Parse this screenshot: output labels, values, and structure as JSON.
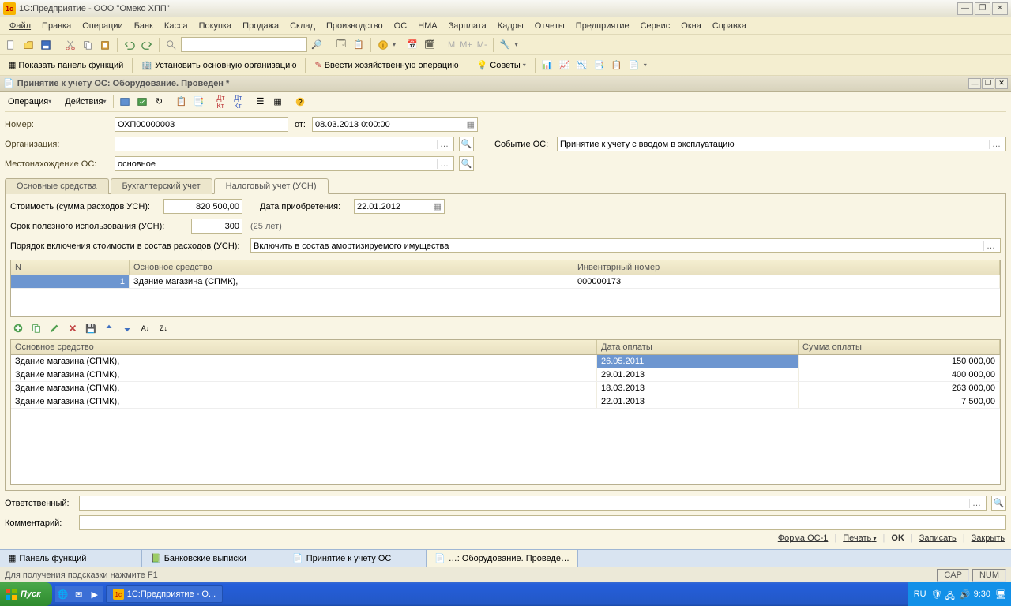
{
  "titlebar": {
    "title": "1С:Предприятие - ООО \"Омеко ХПП\""
  },
  "menubar": [
    "Файл",
    "Правка",
    "Операции",
    "Банк",
    "Касса",
    "Покупка",
    "Продажа",
    "Склад",
    "Производство",
    "ОС",
    "НМА",
    "Зарплата",
    "Кадры",
    "Отчеты",
    "Предприятие",
    "Сервис",
    "Окна",
    "Справка"
  ],
  "toolbar2": {
    "panel_func": "Показать панель функций",
    "set_org": "Установить основную организацию",
    "enter_op": "Ввести хозяйственную операцию",
    "tips": "Советы"
  },
  "subwin": {
    "title": "Принятие к учету ОС: Оборудование. Проведен *"
  },
  "form_tb": {
    "operation": "Операция",
    "actions": "Действия"
  },
  "form": {
    "number_lbl": "Номер:",
    "number": "ОХП00000003",
    "from_lbl": "от:",
    "date": "08.03.2013  0:00:00",
    "org_lbl": "Организация:",
    "org": "",
    "event_lbl": "Событие ОС:",
    "event": "Принятие к учету с вводом в эксплуатацию",
    "loc_lbl": "Местонахождение ОС:",
    "loc": "основное"
  },
  "tabs": [
    "Основные средства",
    "Бухгалтерский учет",
    "Налоговый учет (УСН)"
  ],
  "tax": {
    "cost_lbl": "Стоимость (сумма расходов УСН):",
    "cost": "820 500,00",
    "acq_lbl": "Дата приобретения:",
    "acq": "22.01.2012",
    "life_lbl": "Срок полезного использования (УСН):",
    "life": "300",
    "life_note": "(25 лет)",
    "order_lbl": "Порядок включения стоимости в состав расходов (УСН):",
    "order": "Включить в состав амортизируемого имущества"
  },
  "grid1": {
    "headers": [
      "N",
      "Основное средство",
      "Инвентарный номер"
    ],
    "rows": [
      {
        "n": "1",
        "name": "Здание магазина  (СПМК),",
        "inv": "000000173"
      }
    ]
  },
  "grid2": {
    "headers": [
      "Основное средство",
      "Дата оплаты",
      "Сумма оплаты"
    ],
    "rows": [
      {
        "n": "Здание магазина  (СПМК),",
        "d": "26.05.2011",
        "s": "150 000,00",
        "sel": true
      },
      {
        "n": "Здание магазина  (СПМК),",
        "d": "29.01.2013",
        "s": "400 000,00"
      },
      {
        "n": "Здание магазина  (СПМК),",
        "d": "18.03.2013",
        "s": "263 000,00"
      },
      {
        "n": "Здание магазина  (СПМК),",
        "d": "22.01.2013",
        "s": "7 500,00"
      }
    ]
  },
  "bottom": {
    "resp_lbl": "Ответственный:",
    "comment_lbl": "Комментарий:"
  },
  "footer_btns": {
    "form": "Форма ОС-1",
    "print": "Печать",
    "ok": "OK",
    "save": "Записать",
    "close": "Закрыть"
  },
  "mdi": [
    "Панель функций",
    "Банковские выписки",
    "Принятие к учету ОС",
    "…: Оборудование. Проведе…"
  ],
  "status": {
    "hint": "Для получения подсказки нажмите F1",
    "cap": "CAP",
    "num": "NUM"
  },
  "taskbar": {
    "start": "Пуск",
    "app": "1С:Предприятие - О...",
    "lang": "RU",
    "time": "9:30"
  }
}
